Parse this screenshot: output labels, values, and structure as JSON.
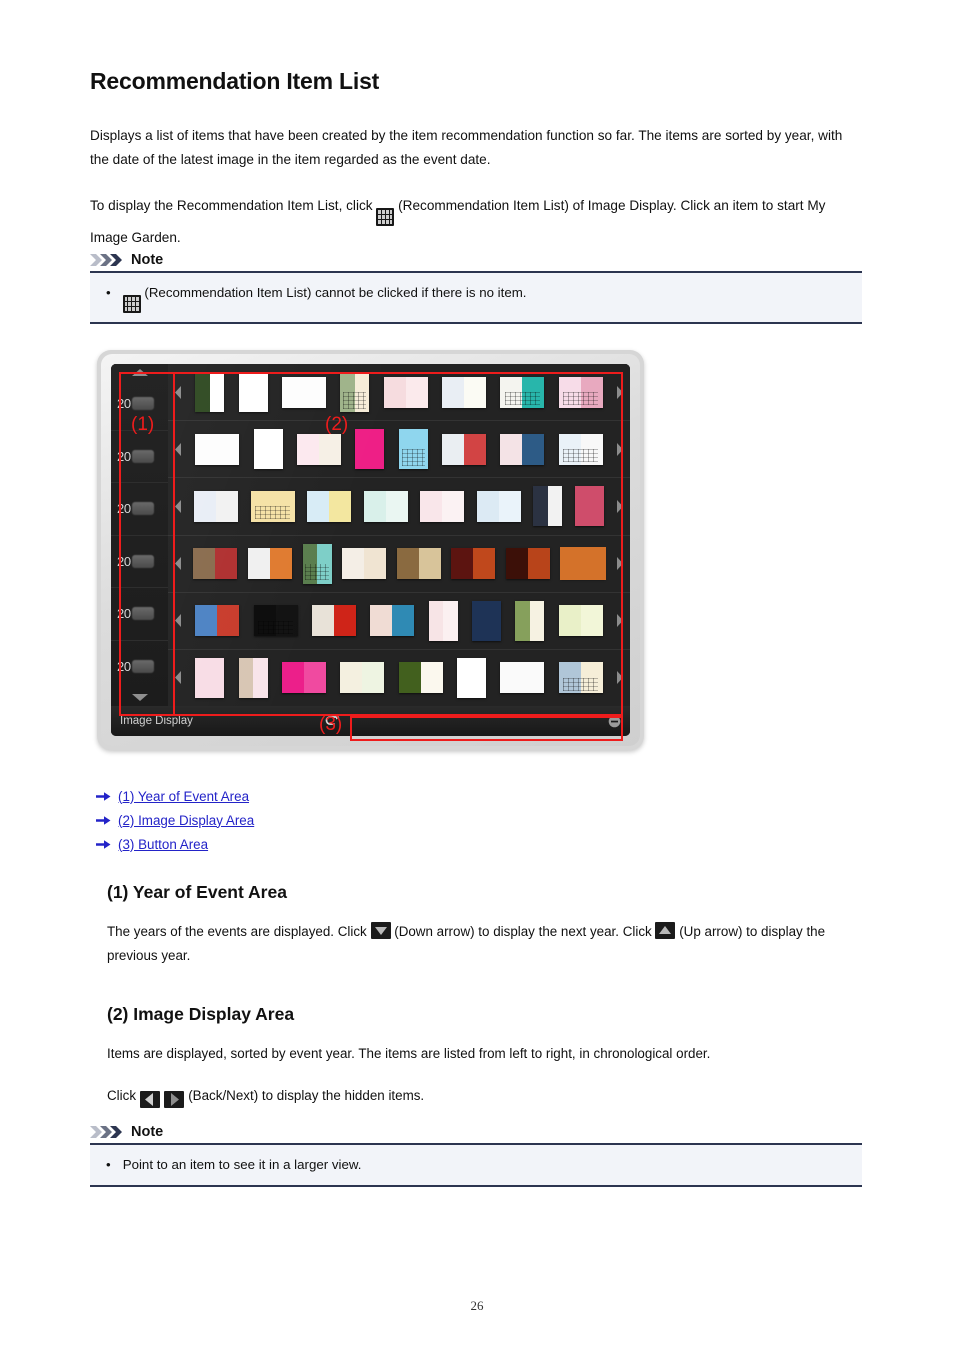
{
  "document": {
    "title": "Recommendation Item List",
    "page_number": "26"
  },
  "intro": {
    "paragraph_1": "Displays a list of items that have been created by the item recommendation function so far. The items are sorted by year, with the date of the latest image in the item regarded as the event date.",
    "paragraph_2_before": "To display the Recommendation Item List, click",
    "paragraph_2_after": "(Recommendation Item List) of Image Display. Click an item to start My Image Garden.",
    "grid_icon_name": "recommendation-item-list-icon"
  },
  "note_1": {
    "heading": "Note",
    "bullet_char": "•",
    "text_after_icon": "(Recommendation Item List) cannot be clicked if there is no item."
  },
  "note_2": {
    "heading": "Note",
    "bullet_char": "•",
    "text": "Point to an item to see it in a larger view."
  },
  "figure": {
    "annotation_labels": {
      "year_area": "(1)",
      "image_display_area": "(2)",
      "button_area": "(3)"
    },
    "year_area": {
      "up_arrow_label": "Up arrow",
      "down_arrow_label": "Down arrow",
      "years": [
        {
          "prefix": "20",
          "masked": true
        },
        {
          "prefix": "20",
          "masked": true
        },
        {
          "prefix": "20",
          "masked": true
        },
        {
          "prefix": "20",
          "masked": true
        },
        {
          "prefix": "20",
          "masked": true
        },
        {
          "prefix": "20",
          "masked": true
        }
      ]
    },
    "image_display_area": {
      "back_label": "Back",
      "next_label": "Next",
      "rows": [
        {
          "items": [
            {
              "shape": "port",
              "left": "#2f4a22",
              "right": "#ffffff",
              "style": "plain"
            },
            {
              "shape": "port",
              "left": "#ffffff",
              "right": "#ffffff",
              "style": "spk"
            },
            {
              "shape": "land",
              "left": "#fdfdfd",
              "right": "#fdfdfd",
              "style": "spk"
            },
            {
              "shape": "port",
              "left": "#9fb38a",
              "right": "#f6ecd8",
              "style": "cal"
            },
            {
              "shape": "land",
              "left": "#f6dcdf",
              "right": "#fbeaec",
              "style": "plain"
            },
            {
              "shape": "land",
              "left": "#e9eef4",
              "right": "#fbfbf4",
              "style": "plain"
            },
            {
              "shape": "land",
              "left": "#f4f4ef",
              "right": "#28b6ab",
              "style": "cal"
            },
            {
              "shape": "land",
              "left": "#f7dce8",
              "right": "#e8a9bf",
              "style": "cal"
            }
          ]
        },
        {
          "items": [
            {
              "shape": "land",
              "left": "#fdfdfd",
              "right": "#fdfdfd",
              "style": "spk"
            },
            {
              "shape": "port",
              "left": "#ffffff",
              "right": "#ffffff",
              "style": "plain"
            },
            {
              "shape": "land",
              "left": "#fce9ef",
              "right": "#f6f0e6",
              "style": "spk"
            },
            {
              "shape": "port",
              "left": "#ee1f86",
              "right": "#ee1f86",
              "style": "spk"
            },
            {
              "shape": "port",
              "left": "#8fd6ee",
              "right": "#8fd6ee",
              "style": "cal"
            },
            {
              "shape": "land",
              "left": "#eaeef2",
              "right": "#d24444",
              "style": "spk"
            },
            {
              "shape": "land",
              "left": "#f4e3e6",
              "right": "#2d5b86",
              "style": "spk"
            },
            {
              "shape": "land",
              "left": "#eaf2f8",
              "right": "#f8f8f8",
              "style": "cal"
            }
          ]
        },
        {
          "items": [
            {
              "shape": "land",
              "left": "#e9eef6",
              "right": "#f2f2f2",
              "style": "spk"
            },
            {
              "shape": "land",
              "left": "#f5e2a6",
              "right": "#f5e2a6",
              "style": "cal"
            },
            {
              "shape": "land",
              "left": "#d8ecf6",
              "right": "#f3e7a0",
              "style": "spk"
            },
            {
              "shape": "land",
              "left": "#d9f0ea",
              "right": "#eaf6f2",
              "style": "spk"
            },
            {
              "shape": "land",
              "left": "#f9e6ea",
              "right": "#fbf2f3",
              "style": "spk"
            },
            {
              "shape": "land",
              "left": "#dceaf4",
              "right": "#eaf3fa",
              "style": "spk"
            },
            {
              "shape": "port",
              "left": "#2b3242",
              "right": "#f2f2f2",
              "style": "plain"
            },
            {
              "shape": "port",
              "left": "#cf4d6b",
              "right": "#cf4d6b",
              "style": "spk"
            }
          ]
        },
        {
          "items": [
            {
              "shape": "land",
              "left": "#8a6c4e",
              "right": "#b03030",
              "style": "plain"
            },
            {
              "shape": "land",
              "left": "#f0f0f0",
              "right": "#e07b30",
              "style": "plain"
            },
            {
              "shape": "port",
              "left": "#5a7e4e",
              "right": "#7ecfc8",
              "style": "cal"
            },
            {
              "shape": "land",
              "left": "#f4eee6",
              "right": "#f0e4d2",
              "style": "spk"
            },
            {
              "shape": "land",
              "left": "#8a6a40",
              "right": "#d8c49a",
              "style": "plain"
            },
            {
              "shape": "land",
              "left": "#5c1410",
              "right": "#c0481c",
              "style": "plain"
            },
            {
              "shape": "land",
              "left": "#3c1008",
              "right": "#b8441a",
              "style": "plain"
            },
            {
              "shape": "land",
              "left": "#d4722a",
              "right": "#d4722a",
              "style": "sel"
            }
          ]
        },
        {
          "items": [
            {
              "shape": "land",
              "left": "#4d83c4",
              "right": "#c83c2c",
              "style": "spk"
            },
            {
              "shape": "land",
              "left": "#0c0c0c",
              "right": "#121212",
              "style": "cal"
            },
            {
              "shape": "land",
              "left": "#e8e2d8",
              "right": "#cf2418",
              "style": "spk"
            },
            {
              "shape": "land",
              "left": "#f0dcd4",
              "right": "#2f8ab4",
              "style": "spk"
            },
            {
              "shape": "port",
              "left": "#f7e4e6",
              "right": "#fbf0f1",
              "style": "plain"
            },
            {
              "shape": "port",
              "left": "#1e3356",
              "right": "#1e3356",
              "style": "plain"
            },
            {
              "shape": "port",
              "left": "#86a05c",
              "right": "#f6f2e2",
              "style": "plain"
            },
            {
              "shape": "land",
              "left": "#e9f0c8",
              "right": "#f2f6d8",
              "style": "spk"
            }
          ]
        },
        {
          "items": [
            {
              "shape": "port",
              "left": "#f8dde6",
              "right": "#f8dde6",
              "style": "spk"
            },
            {
              "shape": "port",
              "left": "#d8c6b4",
              "right": "#f8e4ea",
              "style": "plain"
            },
            {
              "shape": "land",
              "left": "#ec1f8a",
              "right": "#f04aa0",
              "style": "spk"
            },
            {
              "shape": "land",
              "left": "#f4f0e0",
              "right": "#eef4e2",
              "style": "spk"
            },
            {
              "shape": "land",
              "left": "#42601e",
              "right": "#fbf8ee",
              "style": "plain"
            },
            {
              "shape": "port",
              "left": "#ffffff",
              "right": "#ffffff",
              "style": "spk"
            },
            {
              "shape": "land",
              "left": "#fafafa",
              "right": "#fafafa",
              "style": "spk"
            },
            {
              "shape": "land",
              "left": "#b0c6d8",
              "right": "#f6eed8",
              "style": "cal"
            }
          ]
        }
      ]
    },
    "button_area": {
      "label": "Image Display",
      "back_button_name": "back-button",
      "minimize_button_name": "minimize-button"
    }
  },
  "links": [
    {
      "label": "(1) Year of Event Area"
    },
    {
      "label": "(2) Image Display Area"
    },
    {
      "label": "(3) Button Area"
    }
  ],
  "sections": {
    "year_of_event_area": {
      "heading": "(1) Year of Event Area",
      "text_part_1": "The years of the events are displayed. Click",
      "text_part_2": "(Down arrow) to display the next year. Click",
      "text_part_3": "(Up arrow) to display the previous year."
    },
    "image_display_area": {
      "heading": "(2) Image Display Area",
      "text_1": "Items are displayed, sorted by event year. The items are listed from left to right, in chronological order.",
      "text_2_before": "Click",
      "text_2_after": "(Back/Next) to display the hidden items."
    }
  },
  "colors": {
    "link": "#2323c8",
    "annotation_red": "#ee1c1c",
    "note_border": "#2c3550",
    "note_bg": "#f2f4f9",
    "ui_dark": "#1f1f1f"
  }
}
